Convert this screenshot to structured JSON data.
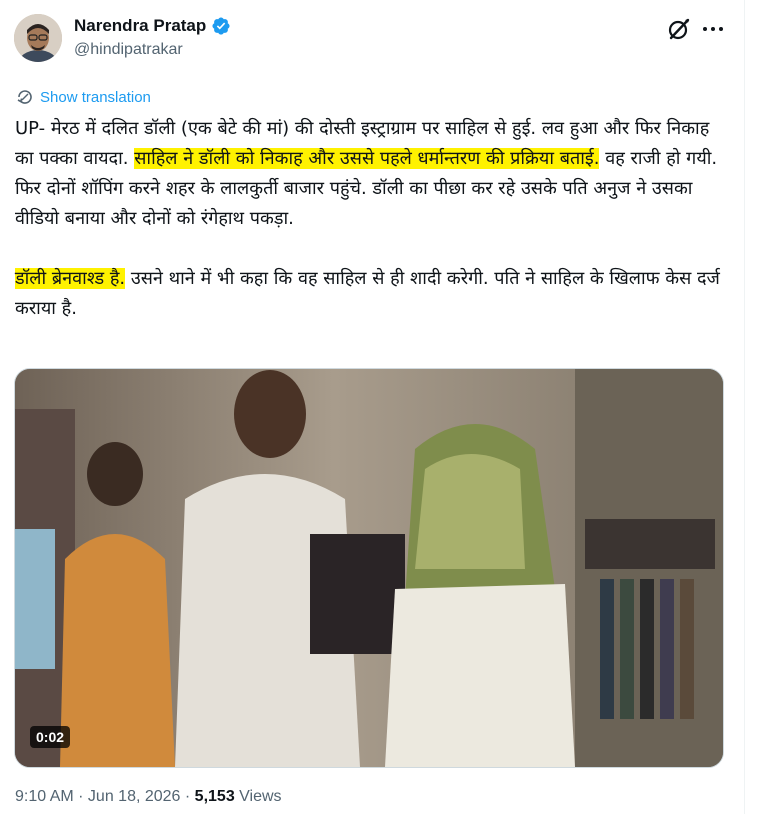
{
  "author": {
    "name": "Narendra Pratap",
    "handle": "@hindipatrakar",
    "verified": true
  },
  "translate_label": "Show translation",
  "tweet": {
    "p1_a": "UP- मेरठ में दलित डॉली (एक बेटे की मां) की दोस्ती इस्ट्राग्राम पर साहिल से हुई. लव हुआ और फिर निकाह का पक्का वायदा. ",
    "p1_hl": "साहिल ने डॉली को निकाह और उससे पहले धर्मान्तरण की प्रक्रिया बताई.",
    "p1_b": " वह राजी हो गयी. फिर दोनों शॉपिंग करने शहर के लालकुर्ती बाजार पहुंचे. डॉली का पीछा कर रहे उसके पति अनुज ने उसका वीडियो बनाया और दोनों को रंगेहाथ पकड़ा.",
    "p2_hl": "डॉली ब्रेनवाश्ड है.",
    "p2_b": " उसने थाने में भी कहा कि वह साहिल से ही शादी करेगी. पति ने साहिल के खिलाफ केस दर्ज कराया है."
  },
  "video": {
    "duration": "0:02"
  },
  "meta": {
    "time": "9:10 AM",
    "separator": " · ",
    "date": "Jun 18, 2026",
    "views_count": "5,153",
    "views_label": " Views"
  },
  "colors": {
    "accent": "#1d9bf0",
    "highlight": "#fff200",
    "muted": "#536471"
  }
}
